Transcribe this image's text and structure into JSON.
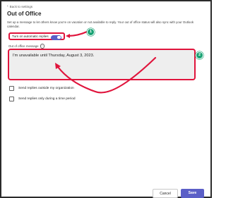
{
  "back_link": {
    "icon": "chevron-left-icon",
    "label": "Back to settings"
  },
  "title": "Out of Office",
  "description": "Set up a message to let others know you're on vacation or not available to reply. Your out of office status will also sync with your Outlook calendar.",
  "auto_reply_toggle": {
    "label": "Turn on automatic replies",
    "on": true,
    "color": "#5b5fc7"
  },
  "message": {
    "label": "Out of office message",
    "info_icon": "info-icon",
    "value": "I'm unavailable until Thursday, August 3, 2023."
  },
  "options": [
    {
      "label": "Send replies outside my organization",
      "checked": false
    },
    {
      "label": "Send replies only during a time period",
      "checked": false
    }
  ],
  "buttons": {
    "cancel": "Cancel",
    "save": "Save"
  },
  "annotations": {
    "badge_1": "1",
    "badge_2": "2",
    "highlight_color": "#e0143c",
    "badge_color": "#19a374"
  }
}
